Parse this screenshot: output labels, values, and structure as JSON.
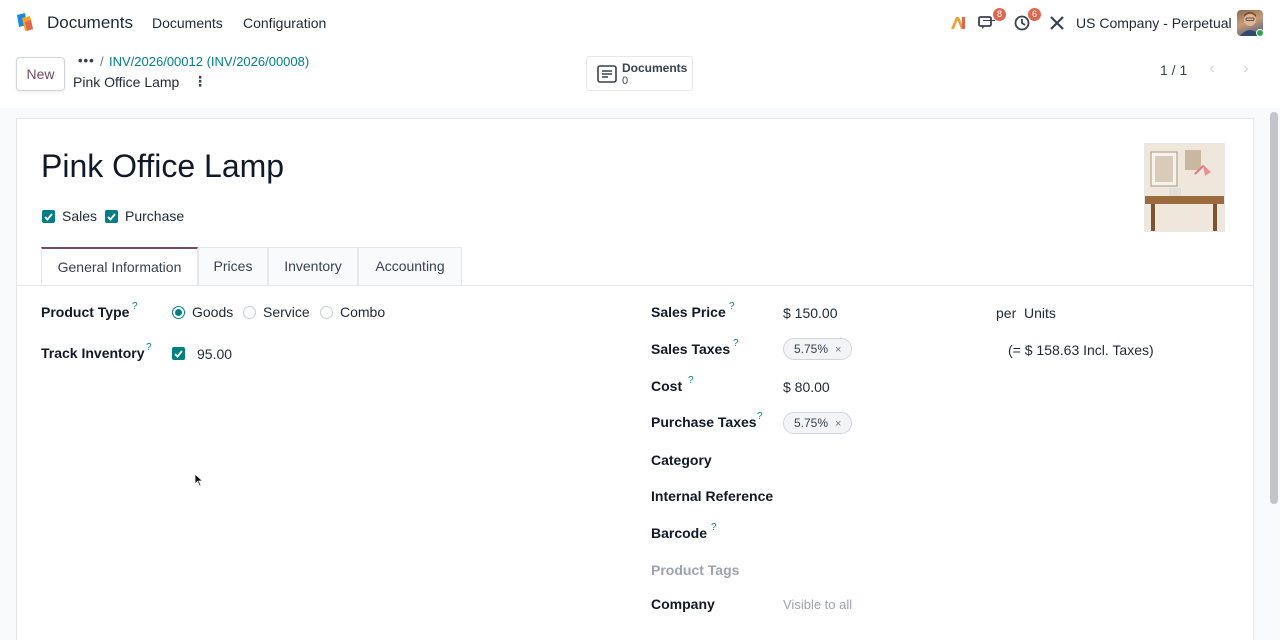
{
  "navbar": {
    "app_name": "Documents",
    "menu": [
      "Documents",
      "Configuration"
    ],
    "messages_badge": "8",
    "activities_badge": "6",
    "company": "US Company - Perpetual",
    "icons": [
      "ai-icon",
      "messages-icon",
      "activities-icon",
      "tools-icon"
    ]
  },
  "control": {
    "new_label": "New",
    "breadcrumb_dots": "•••",
    "breadcrumb_sep": "/",
    "breadcrumb_parent": "INV/2026/00012 (INV/2026/00008)",
    "breadcrumb_current": "Pink Office Lamp",
    "gear_label": "⋮",
    "smart_button": {
      "label": "Documents",
      "count": "0"
    },
    "pager": "1 / 1",
    "pager_prev": "‹",
    "pager_next": "›"
  },
  "form": {
    "title": "Pink Office Lamp",
    "flags": [
      {
        "label": "Sales",
        "checked": true
      },
      {
        "label": "Purchase",
        "checked": true
      }
    ],
    "tabs": [
      "General Information",
      "Prices",
      "Inventory",
      "Accounting"
    ],
    "active_tab": "General Information",
    "left": {
      "product_type_label": "Product Type",
      "product_type_options": [
        "Goods",
        "Service",
        "Combo"
      ],
      "product_type_selected": "Goods",
      "track_inventory_label": "Track Inventory",
      "track_inventory_value": "95.00",
      "help": "?"
    },
    "right": {
      "sales_price_label": "Sales Price",
      "sales_price_value": "$ 150.00",
      "per_label": "per",
      "uom": "Units",
      "sales_taxes_label": "Sales Taxes",
      "sales_tax_tag": "5.75%",
      "incl_taxes": "(= $ 158.63 Incl. Taxes)",
      "cost_label": "Cost",
      "cost_value": "$ 80.00",
      "purchase_taxes_label": "Purchase Taxes",
      "purchase_tax_tag": "5.75%",
      "category_label": "Category",
      "internal_ref_label": "Internal Reference",
      "barcode_label": "Barcode",
      "product_tags_label": "Product Tags",
      "company_label": "Company",
      "company_placeholder": "Visible to all",
      "tag_remove": "×"
    }
  },
  "colors": {
    "accent": "#017e84",
    "brand": "#714b67",
    "badge": "#e0674f"
  }
}
